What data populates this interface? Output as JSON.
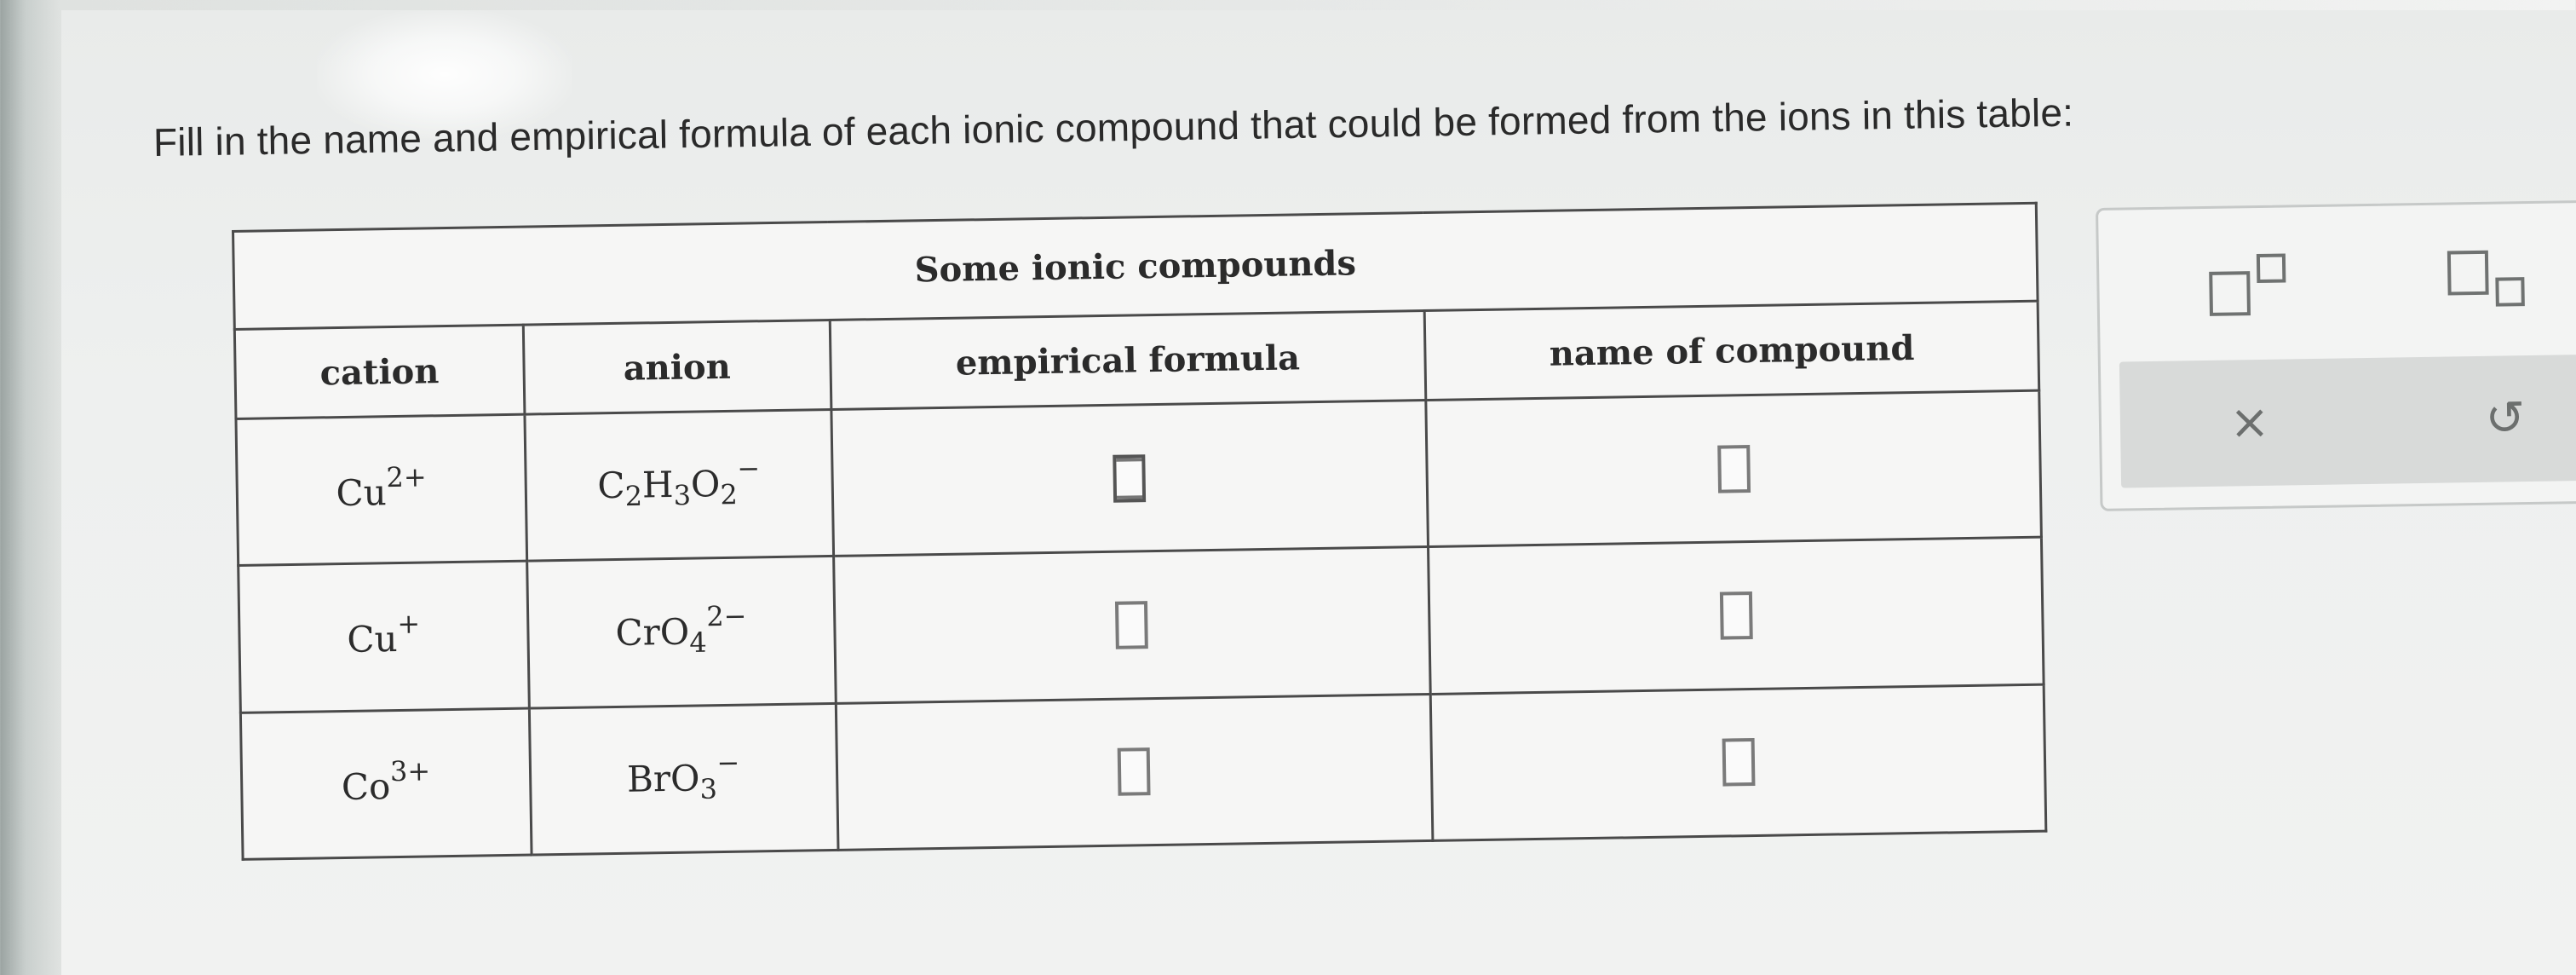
{
  "prompt": {
    "text": "Fill in the name and empirical formula of each ionic compound that could be formed from the ions in this table:"
  },
  "table": {
    "caption": "Some ionic compounds",
    "headers": {
      "cation": "cation",
      "anion": "anion",
      "formula": "empirical formula",
      "name": "name of compound"
    },
    "rows": [
      {
        "cation": {
          "base": "Cu",
          "charge": "2+"
        },
        "anion": {
          "parts": [
            [
              "C",
              "2"
            ],
            [
              "H",
              "3"
            ],
            [
              "O",
              "2"
            ]
          ],
          "charge": "−"
        },
        "formula_value": "",
        "name_value": ""
      },
      {
        "cation": {
          "base": "Cu",
          "charge": "+"
        },
        "anion": {
          "parts": [
            [
              "CrO",
              "4"
            ]
          ],
          "charge": "2−"
        },
        "formula_value": "",
        "name_value": ""
      },
      {
        "cation": {
          "base": "Co",
          "charge": "3+"
        },
        "anion": {
          "parts": [
            [
              "BrO",
              "3"
            ]
          ],
          "charge": "−"
        },
        "formula_value": "",
        "name_value": ""
      }
    ]
  },
  "palette": {
    "tools": [
      {
        "name": "superscript-icon"
      },
      {
        "name": "subscript-icon"
      }
    ],
    "actions": [
      {
        "label": "×",
        "name": "clear-button"
      },
      {
        "label": "↺",
        "name": "undo-button"
      }
    ]
  }
}
